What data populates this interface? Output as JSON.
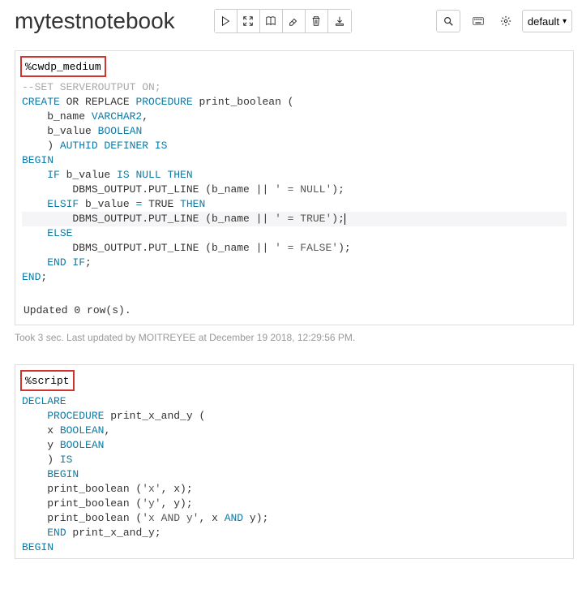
{
  "header": {
    "title": "mytestnotebook",
    "dropdown_label": "default"
  },
  "icons": {
    "play": "play",
    "collapse": "collapse",
    "book": "book",
    "eraser": "eraser",
    "trash": "trash",
    "download": "download",
    "search": "search",
    "keyboard": "keyboard",
    "gear": "gear"
  },
  "cell1": {
    "directive": "%cwdp_medium",
    "code": [
      {
        "t": "--SET SERVEROUTPUT ON;",
        "cls": "cm",
        "ind": 0
      },
      {
        "segs": [
          {
            "t": "CREATE",
            "c": "kw"
          },
          {
            "t": " OR REPLACE "
          },
          {
            "t": "PROCEDURE",
            "c": "kw"
          },
          {
            "t": " print_boolean ("
          }
        ],
        "ind": 0
      },
      {
        "segs": [
          {
            "t": "b_name "
          },
          {
            "t": "VARCHAR2",
            "c": "kw"
          },
          {
            "t": ","
          }
        ],
        "ind": 4
      },
      {
        "segs": [
          {
            "t": "b_value "
          },
          {
            "t": "BOOLEAN",
            "c": "kw"
          }
        ],
        "ind": 4
      },
      {
        "segs": [
          {
            "t": ") "
          },
          {
            "t": "AUTHID DEFINER IS",
            "c": "kw"
          }
        ],
        "ind": 4
      },
      {
        "segs": [
          {
            "t": "BEGIN",
            "c": "kw"
          }
        ],
        "ind": 0
      },
      {
        "segs": [
          {
            "t": "IF",
            "c": "kw"
          },
          {
            "t": " b_value "
          },
          {
            "t": "IS NULL THEN",
            "c": "kw"
          }
        ],
        "ind": 4
      },
      {
        "segs": [
          {
            "t": "DBMS_OUTPUT.PUT_LINE (b_name || "
          },
          {
            "t": "' = NULL'",
            "c": "str"
          },
          {
            "t": ");"
          }
        ],
        "ind": 8
      },
      {
        "segs": [
          {
            "t": "ELSIF",
            "c": "kw"
          },
          {
            "t": " b_value "
          },
          {
            "t": "=",
            "c": "kw"
          },
          {
            "t": " TRUE "
          },
          {
            "t": "THEN",
            "c": "kw"
          }
        ],
        "ind": 4
      },
      {
        "segs": [
          {
            "t": "DBMS_OUTPUT.PUT_LINE (b_name || "
          },
          {
            "t": "' = TRUE'",
            "c": "str"
          },
          {
            "t": ");"
          }
        ],
        "ind": 8,
        "hl": true,
        "cursor": true
      },
      {
        "segs": [
          {
            "t": "ELSE",
            "c": "kw"
          }
        ],
        "ind": 4
      },
      {
        "segs": [
          {
            "t": "DBMS_OUTPUT.PUT_LINE (b_name || "
          },
          {
            "t": "' = FALSE'",
            "c": "str"
          },
          {
            "t": ");"
          }
        ],
        "ind": 8
      },
      {
        "segs": [
          {
            "t": "END IF",
            "c": "kw"
          },
          {
            "t": ";"
          }
        ],
        "ind": 4
      },
      {
        "segs": [
          {
            "t": "END",
            "c": "kw"
          },
          {
            "t": ";"
          }
        ],
        "ind": 0
      }
    ],
    "output": "Updated 0 row(s).",
    "meta": "Took 3 sec. Last updated by MOITREYEE at December 19 2018, 12:29:56 PM."
  },
  "cell2": {
    "directive": "%script",
    "code": [
      {
        "segs": [
          {
            "t": "DECLARE",
            "c": "kw"
          }
        ],
        "ind": 0
      },
      {
        "segs": [
          {
            "t": "PROCEDURE",
            "c": "kw"
          },
          {
            "t": " print_x_and_y ("
          }
        ],
        "ind": 4
      },
      {
        "segs": [
          {
            "t": "x "
          },
          {
            "t": "BOOLEAN",
            "c": "kw"
          },
          {
            "t": ","
          }
        ],
        "ind": 4
      },
      {
        "segs": [
          {
            "t": "y "
          },
          {
            "t": "BOOLEAN",
            "c": "kw"
          }
        ],
        "ind": 4
      },
      {
        "segs": [
          {
            "t": ") "
          },
          {
            "t": "IS",
            "c": "kw"
          }
        ],
        "ind": 4
      },
      {
        "segs": [
          {
            "t": "BEGIN",
            "c": "kw"
          }
        ],
        "ind": 4
      },
      {
        "segs": [
          {
            "t": "print_boolean ("
          },
          {
            "t": "'x'",
            "c": "str"
          },
          {
            "t": ", x);"
          }
        ],
        "ind": 4
      },
      {
        "segs": [
          {
            "t": "print_boolean ("
          },
          {
            "t": "'y'",
            "c": "str"
          },
          {
            "t": ", y);"
          }
        ],
        "ind": 4
      },
      {
        "segs": [
          {
            "t": "print_boolean ("
          },
          {
            "t": "'x AND y'",
            "c": "str"
          },
          {
            "t": ", x "
          },
          {
            "t": "AND",
            "c": "kw"
          },
          {
            "t": " y);"
          }
        ],
        "ind": 4
      },
      {
        "segs": [
          {
            "t": "END",
            "c": "kw"
          },
          {
            "t": " print_x_and_y;"
          }
        ],
        "ind": 4
      },
      {
        "segs": [
          {
            "t": "BEGIN",
            "c": "kw"
          }
        ],
        "ind": 0
      }
    ]
  }
}
